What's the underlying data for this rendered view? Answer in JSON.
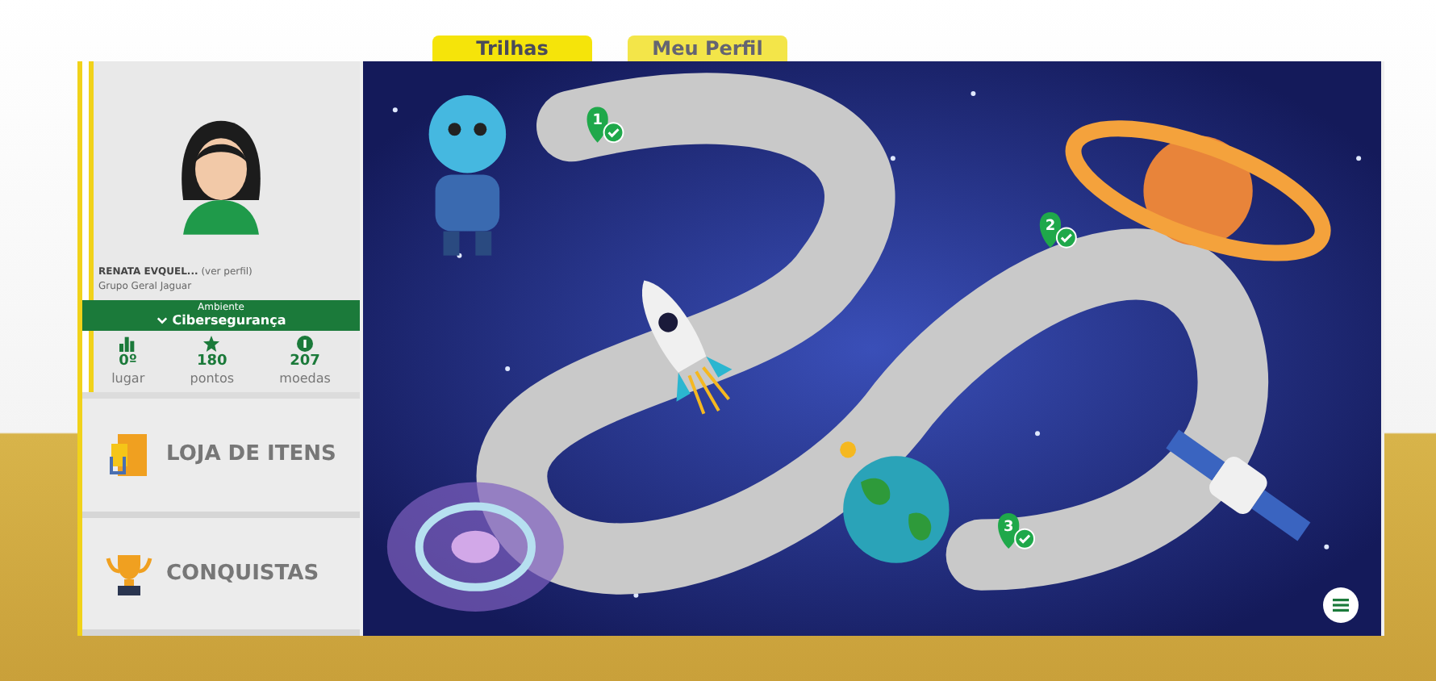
{
  "tabs": [
    {
      "label": "Trilhas",
      "selected": true
    },
    {
      "label": "Meu Perfil",
      "selected": false
    }
  ],
  "profile": {
    "name": "RENATA EVQUEL...",
    "link": "(ver perfil)",
    "group": "Grupo Geral Jaguar"
  },
  "environment": {
    "label": "Ambiente",
    "value": "Cibersegurança"
  },
  "stats": [
    {
      "kind": "rank",
      "value": "0º",
      "label": "lugar"
    },
    {
      "kind": "points",
      "value": "180",
      "label": "pontos"
    },
    {
      "kind": "coins",
      "value": "207",
      "label": "moedas"
    }
  ],
  "menu": [
    {
      "kind": "store",
      "label": "LOJA DE ITENS"
    },
    {
      "kind": "trophy",
      "label": "CONQUISTAS"
    }
  ],
  "trail": {
    "steps": [
      {
        "number": "1",
        "done": true
      },
      {
        "number": "2",
        "done": true
      },
      {
        "number": "3",
        "done": true
      }
    ]
  }
}
